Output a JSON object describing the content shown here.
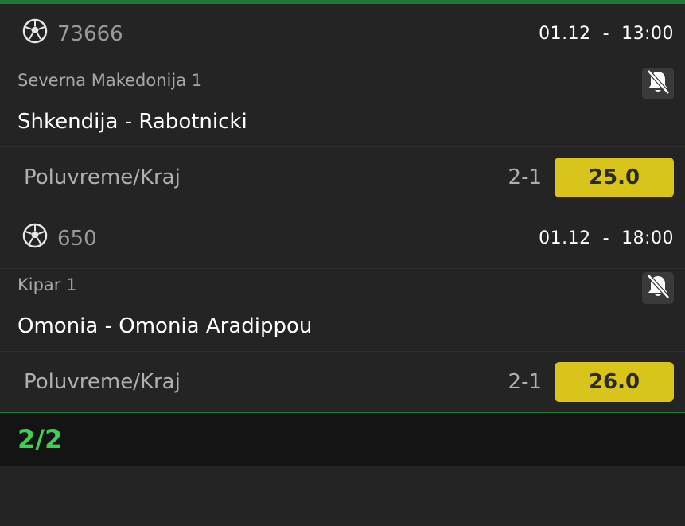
{
  "matches": [
    {
      "code": "73666",
      "date": "01.12",
      "sep": "-",
      "time": "13:00",
      "league": "Severna Makedonija 1",
      "teams": "Shkendija - Rabotnicki",
      "bet_type": "Poluvreme/Kraj",
      "tip": "2-1",
      "odds": "25.0"
    },
    {
      "code": "650",
      "date": "01.12",
      "sep": "-",
      "time": "18:00",
      "league": "Kipar 1",
      "teams": "Omonia - Omonia Aradippou",
      "bet_type": "Poluvreme/Kraj",
      "tip": "2-1",
      "odds": "26.0"
    }
  ],
  "footer": {
    "count": "2/2"
  },
  "icons": {
    "sport": "soccer-ball-icon",
    "notify": "bell-off-icon"
  },
  "colors": {
    "accent_green": "#3fcf55",
    "odds_bg": "#d9c41b",
    "divider_green": "#1f7a35"
  }
}
